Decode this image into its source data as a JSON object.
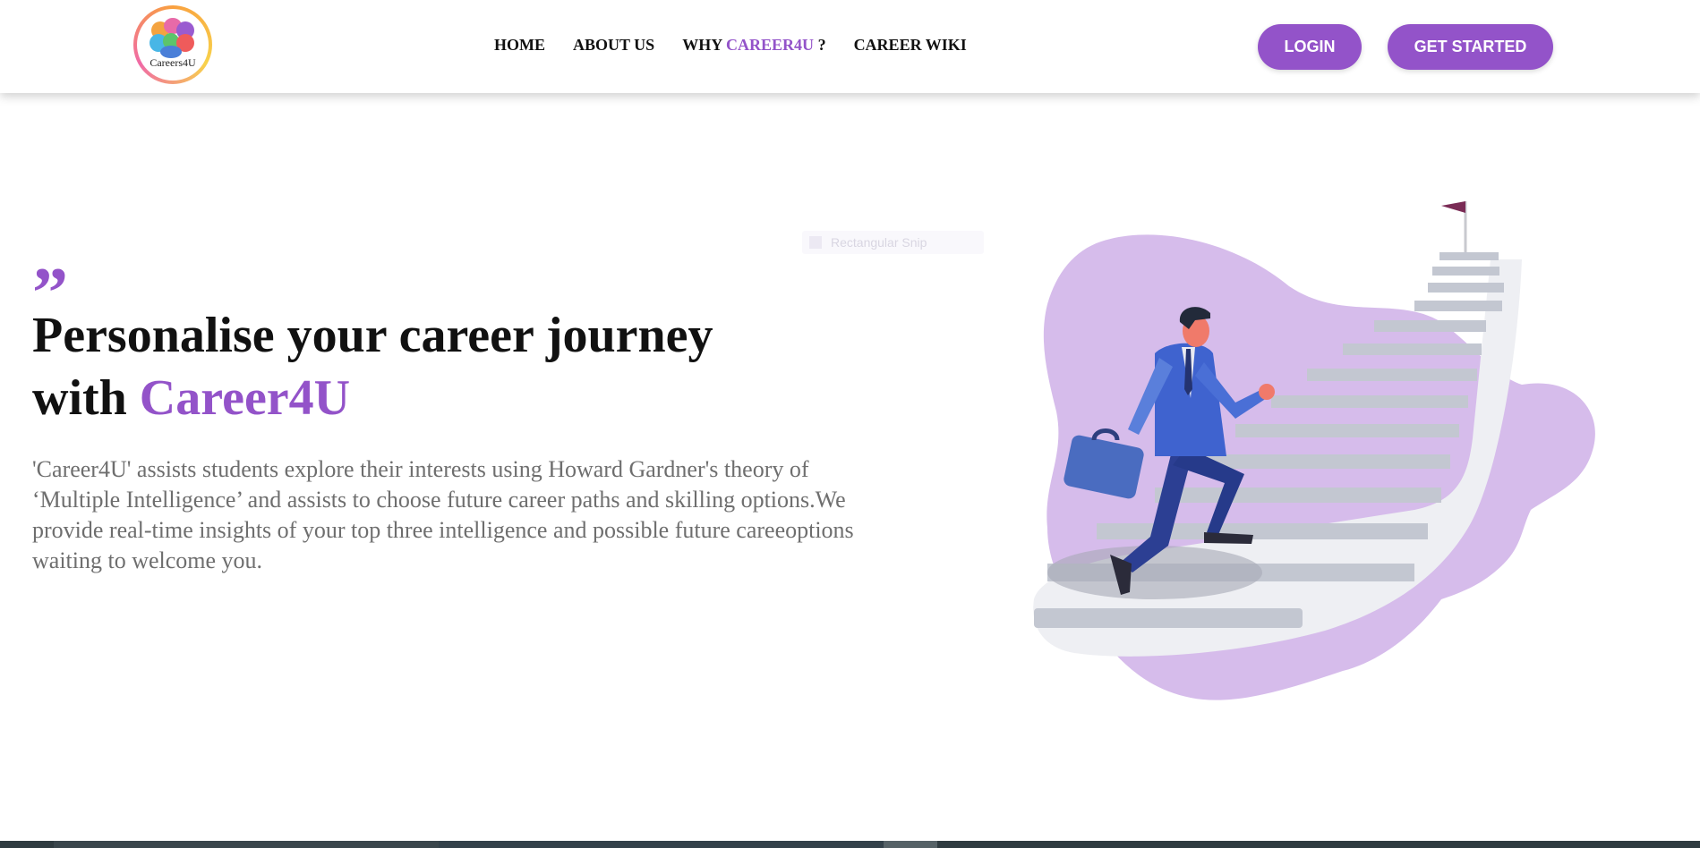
{
  "header": {
    "logo_text": "Careers4U",
    "nav": {
      "home": "HOME",
      "about": "ABOUT US",
      "why_prefix": "WHY ",
      "why_brand": "CAREER4U",
      "why_suffix": " ?",
      "wiki": "CAREER WIKI"
    },
    "login_label": "LOGIN",
    "get_started_label": "GET STARTED"
  },
  "hero": {
    "quote_mark": "”",
    "headline_part1": "Personalise your career journey",
    "headline_part2": "with ",
    "headline_brand": "Career4U",
    "description": "'Career4U' assists students explore their interests using Howard Gardner's theory of ‘Multiple Intelligence’ and assists to choose future career paths and skilling options.We provide real-time insights of your top three intelligence and possible future careeoptions waiting to welcome you.",
    "ghost_chip_label": "Rectangular Snip"
  },
  "colors": {
    "accent": "#9353c9",
    "blob": "#d6bceb",
    "suit": "#3a5bc8",
    "flag": "#7a2b55"
  },
  "icons": {
    "logo": "brain-logo-icon",
    "quote": "quote-icon",
    "illustration": "man-climbing-stairs-illustration"
  }
}
